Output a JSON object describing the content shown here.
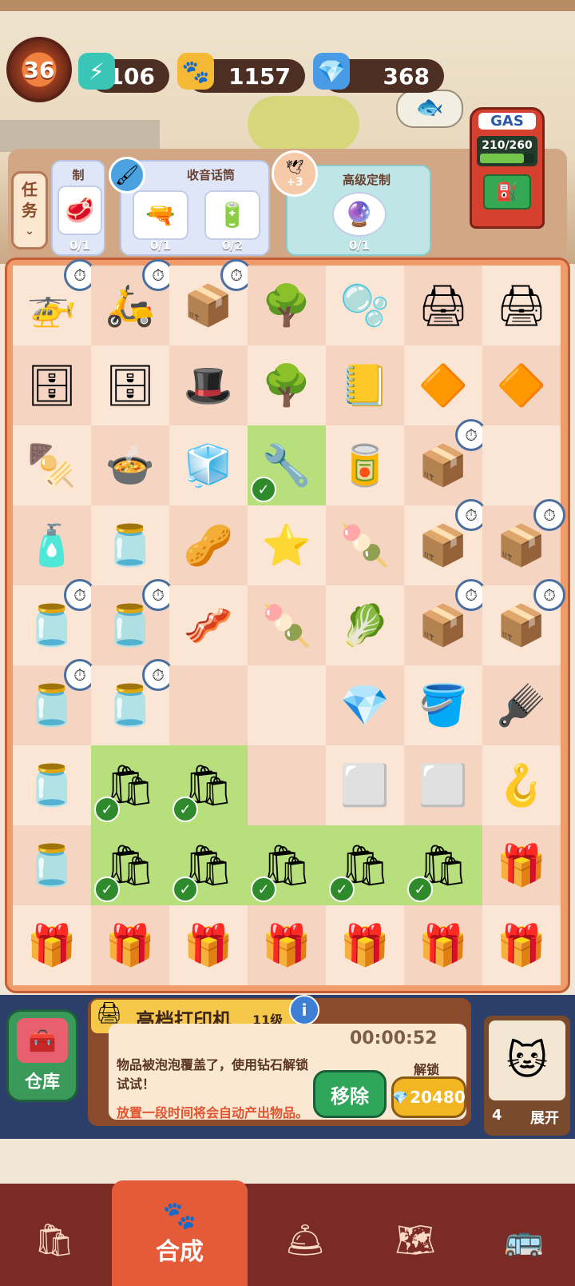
{
  "top_bar": {
    "level": "36",
    "energy": "106",
    "paws": "1157",
    "gems": "368"
  },
  "quests": {
    "task_label_line1": "任",
    "task_label_line2": "务",
    "card1_title": "制",
    "card1_counts": [
      "0/1"
    ],
    "card2_title": "收音话筒",
    "card2_counts": [
      "0/1",
      "0/2"
    ],
    "card3_badge": "+3",
    "card3_title": "高级定制",
    "card3_counts": [
      "0/1"
    ]
  },
  "gas": {
    "label": "GAS",
    "value": "210/260",
    "fill_fraction": 0.81
  },
  "board": {
    "rows": [
      [
        {
          "icon": "🚁",
          "timer": true
        },
        {
          "icon": "🛵",
          "timer": true
        },
        {
          "icon": "📦",
          "timer": true
        },
        {
          "icon": "🌳"
        },
        {
          "icon": "🫧"
        },
        {
          "icon": "🖨"
        },
        {
          "icon": "🖨"
        }
      ],
      [
        {
          "icon": "🗄"
        },
        {
          "icon": "🗄"
        },
        {
          "icon": "🎩"
        },
        {
          "icon": "🌳"
        },
        {
          "icon": "📒"
        },
        {
          "icon": "🔶"
        },
        {
          "icon": "🔶"
        }
      ],
      [
        {
          "icon": "🍢"
        },
        {
          "icon": "🍲"
        },
        {
          "icon": "🧊"
        },
        {
          "icon": "🔧",
          "ready": true
        },
        {
          "icon": "🥫"
        },
        {
          "icon": "📦",
          "timer": true
        },
        {
          "icon": ""
        }
      ],
      [
        {
          "icon": "🧴"
        },
        {
          "icon": "🫙"
        },
        {
          "icon": "🥜"
        },
        {
          "icon": "⭐"
        },
        {
          "icon": "🍡"
        },
        {
          "icon": "📦",
          "timer": true
        },
        {
          "icon": "📦",
          "timer": true
        }
      ],
      [
        {
          "icon": "🫙",
          "timer": true
        },
        {
          "icon": "🫙",
          "timer": true
        },
        {
          "icon": "🥓"
        },
        {
          "icon": "🍡"
        },
        {
          "icon": "🥬"
        },
        {
          "icon": "📦",
          "timer": true
        },
        {
          "icon": "📦",
          "timer": true
        }
      ],
      [
        {
          "icon": "🫙",
          "timer": true
        },
        {
          "icon": "🫙",
          "timer": true
        },
        {
          "icon": ""
        },
        {
          "icon": ""
        },
        {
          "icon": "💎"
        },
        {
          "icon": "🪣"
        },
        {
          "icon": "🪮"
        }
      ],
      [
        {
          "icon": "🫙"
        },
        {
          "icon": "🛍",
          "ready": true
        },
        {
          "icon": "🛍",
          "ready": true
        },
        {
          "icon": ""
        },
        {
          "icon": "⬜"
        },
        {
          "icon": "⬜"
        },
        {
          "icon": "🪝"
        }
      ],
      [
        {
          "icon": "🫙"
        },
        {
          "icon": "🛍",
          "ready": true
        },
        {
          "icon": "🛍",
          "ready": true
        },
        {
          "icon": "🛍",
          "ready": true
        },
        {
          "icon": "🛍",
          "ready": true
        },
        {
          "icon": "🛍",
          "ready": true
        },
        {
          "icon": "🎁"
        }
      ],
      [
        {
          "icon": "🎁"
        },
        {
          "icon": "🎁"
        },
        {
          "icon": "🎁"
        },
        {
          "icon": "🎁"
        },
        {
          "icon": "🎁"
        },
        {
          "icon": "🎁"
        },
        {
          "icon": "🎁"
        }
      ]
    ]
  },
  "info": {
    "warehouse_label": "仓库",
    "item_name": "高档打印机",
    "item_level": "11级",
    "timer": "00:00:52",
    "desc_line1": "物品被泡泡覆盖了，使用钻石解锁",
    "desc_line2": "试试！",
    "desc_line3": "放置一段时间将会自动产出物品。",
    "remove_label": "移除",
    "unlock_label": "解锁",
    "unlock_cost": "20480",
    "side_count": "4",
    "expand_label": "展开"
  },
  "nav": {
    "merge_label": "合成",
    "items": [
      "shop-bag-icon",
      "merge-icon",
      "service-bell-icon",
      "map-icon",
      "bus-icon"
    ]
  }
}
